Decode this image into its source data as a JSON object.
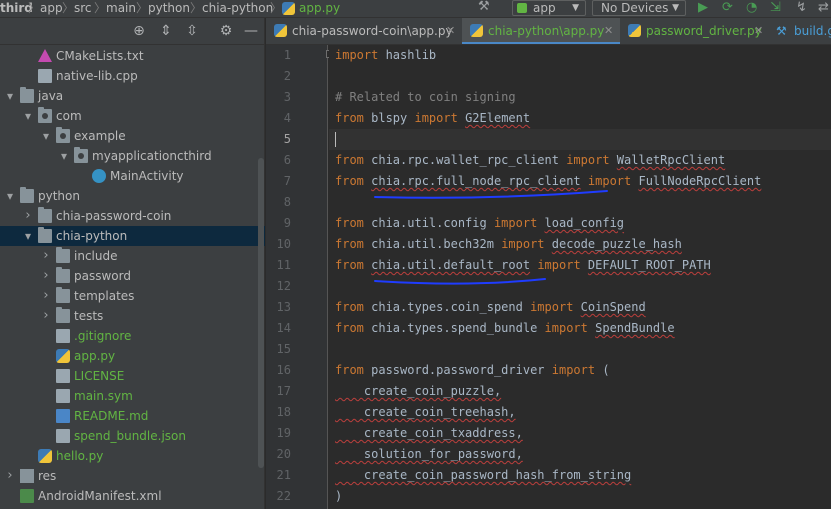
{
  "breadcrumb": [
    "third",
    "app",
    "src",
    "main",
    "python",
    "chia-python",
    "app.py"
  ],
  "toolbar": {
    "run_config": "app",
    "device": "No Devices"
  },
  "tree": [
    {
      "label": "CMakeLists.txt",
      "icon": "cmake-icon",
      "depth": 1,
      "color": "#bbbbbb"
    },
    {
      "label": "native-lib.cpp",
      "icon": "cpp-file-icon",
      "depth": 1,
      "color": "#bbbbbb"
    },
    {
      "label": "java",
      "icon": "folder-icon",
      "depth": 0,
      "expanded": true,
      "color": "#bbbbbb"
    },
    {
      "label": "com",
      "icon": "package-icon",
      "depth": 1,
      "expanded": true,
      "color": "#bbbbbb"
    },
    {
      "label": "example",
      "icon": "package-icon",
      "depth": 2,
      "expanded": true,
      "color": "#bbbbbb"
    },
    {
      "label": "myapplicationcthird",
      "icon": "package-icon",
      "depth": 3,
      "expanded": true,
      "color": "#bbbbbb"
    },
    {
      "label": "MainActivity",
      "icon": "activity-icon",
      "depth": 4,
      "color": "#bbbbbb"
    },
    {
      "label": "python",
      "icon": "folder-icon",
      "depth": 0,
      "expanded": true,
      "color": "#bbbbbb"
    },
    {
      "label": "chia-password-coin",
      "icon": "folder-icon",
      "depth": 1,
      "expanded": false,
      "color": "#bbbbbb"
    },
    {
      "label": "chia-python",
      "icon": "folder-icon",
      "depth": 1,
      "expanded": true,
      "selected": true,
      "color": "#bbbbbb"
    },
    {
      "label": "include",
      "icon": "folder-icon",
      "depth": 2,
      "expanded": false,
      "color": "#bbbbbb"
    },
    {
      "label": "password",
      "icon": "folder-icon",
      "depth": 2,
      "expanded": false,
      "color": "#bbbbbb"
    },
    {
      "label": "templates",
      "icon": "folder-icon",
      "depth": 2,
      "expanded": false,
      "color": "#bbbbbb"
    },
    {
      "label": "tests",
      "icon": "folder-icon",
      "depth": 2,
      "expanded": false,
      "color": "#bbbbbb"
    },
    {
      "label": ".gitignore",
      "icon": "gitignore-file-icon",
      "depth": 2,
      "color": "#62b543"
    },
    {
      "label": "app.py",
      "icon": "python-file-icon",
      "depth": 2,
      "color": "#62b543"
    },
    {
      "label": "LICENSE",
      "icon": "text-file-icon",
      "depth": 2,
      "color": "#62b543"
    },
    {
      "label": "main.sym",
      "icon": "text-file-icon",
      "depth": 2,
      "color": "#62b543"
    },
    {
      "label": "README.md",
      "icon": "markdown-file-icon",
      "depth": 2,
      "color": "#62b543"
    },
    {
      "label": "spend_bundle.json",
      "icon": "json-file-icon",
      "depth": 2,
      "color": "#62b543"
    },
    {
      "label": "hello.py",
      "icon": "python-file-icon",
      "depth": 1,
      "color": "#62b543"
    },
    {
      "label": "res",
      "icon": "res-folder-icon",
      "depth": 0,
      "expanded": false,
      "color": "#bbbbbb"
    },
    {
      "label": "AndroidManifest.xml",
      "icon": "manifest-file-icon",
      "depth": 0,
      "color": "#bbbbbb"
    }
  ],
  "tabs": [
    {
      "label": "chia-password-coin\\app.py",
      "active": false,
      "color": "#bbbbbb"
    },
    {
      "label": "chia-python\\app.py",
      "active": true,
      "color": "#62b543"
    },
    {
      "label": "password_driver.py",
      "active": false,
      "color": "#62b543"
    },
    {
      "label": "build.g",
      "active": false,
      "color": "#4a9fd8"
    }
  ],
  "line_numbers": [
    "1",
    "2",
    "3",
    "4",
    "5",
    "6",
    "7",
    "8",
    "9",
    "10",
    "11",
    "12",
    "13",
    "14",
    "15",
    "16",
    "17",
    "18",
    "19",
    "20",
    "21",
    "22"
  ],
  "code": {
    "l1_kw": "import",
    "l1_mod": " hashlib",
    "l3": "# Related to coin signing",
    "l4_from": "from",
    "l4_mod": " blspy ",
    "l4_imp": "import",
    "l4_name": "G2Element",
    "l6_from": "from",
    "l6_mod": " chia.rpc.wallet_rpc_client ",
    "l6_imp": "import",
    "l6_name": "WalletRpcClient",
    "l7_from": "from",
    "l7_mod": "chia.rpc.full_node_rpc_client",
    "l7_imp": "import",
    "l7_name": "FullNodeRpcClient",
    "l9_from": "from",
    "l9_mod": " chia.util.config ",
    "l9_imp": "import",
    "l9_name": "load_config",
    "l10_from": "from",
    "l10_mod": " chia.util.bech32m ",
    "l10_imp": "import",
    "l10_name": "decode_puzzle_hash",
    "l11_from": "from",
    "l11_mod": "chia.util.default_root",
    "l11_imp": "import",
    "l11_name": "DEFAULT_ROOT_PATH",
    "l13_from": "from",
    "l13_mod": " chia.types.coin_spend ",
    "l13_imp": "import",
    "l13_name": "CoinSpend",
    "l14_from": "from",
    "l14_mod": " chia.types.spend_bundle ",
    "l14_imp": "import",
    "l14_name": "SpendBundle",
    "l16_from": "from",
    "l16_mod": " password.password_driver ",
    "l16_imp": "import",
    "l16_rest": " (",
    "l17": "    create_coin_puzzle,",
    "l18": "    create_coin_treehash,",
    "l19": "    create_coin_txaddress,",
    "l20": "    solution_for_password,",
    "l21": "    create_coin_password_hash_from_string",
    "l22": ")"
  },
  "colors": {
    "keyword": "#cc7832",
    "comment": "#808080",
    "identifier": "#a9b7c6",
    "vcs_added": "#62b543",
    "selection": "#0d293e",
    "annotation_ink": "#1f3cff"
  }
}
